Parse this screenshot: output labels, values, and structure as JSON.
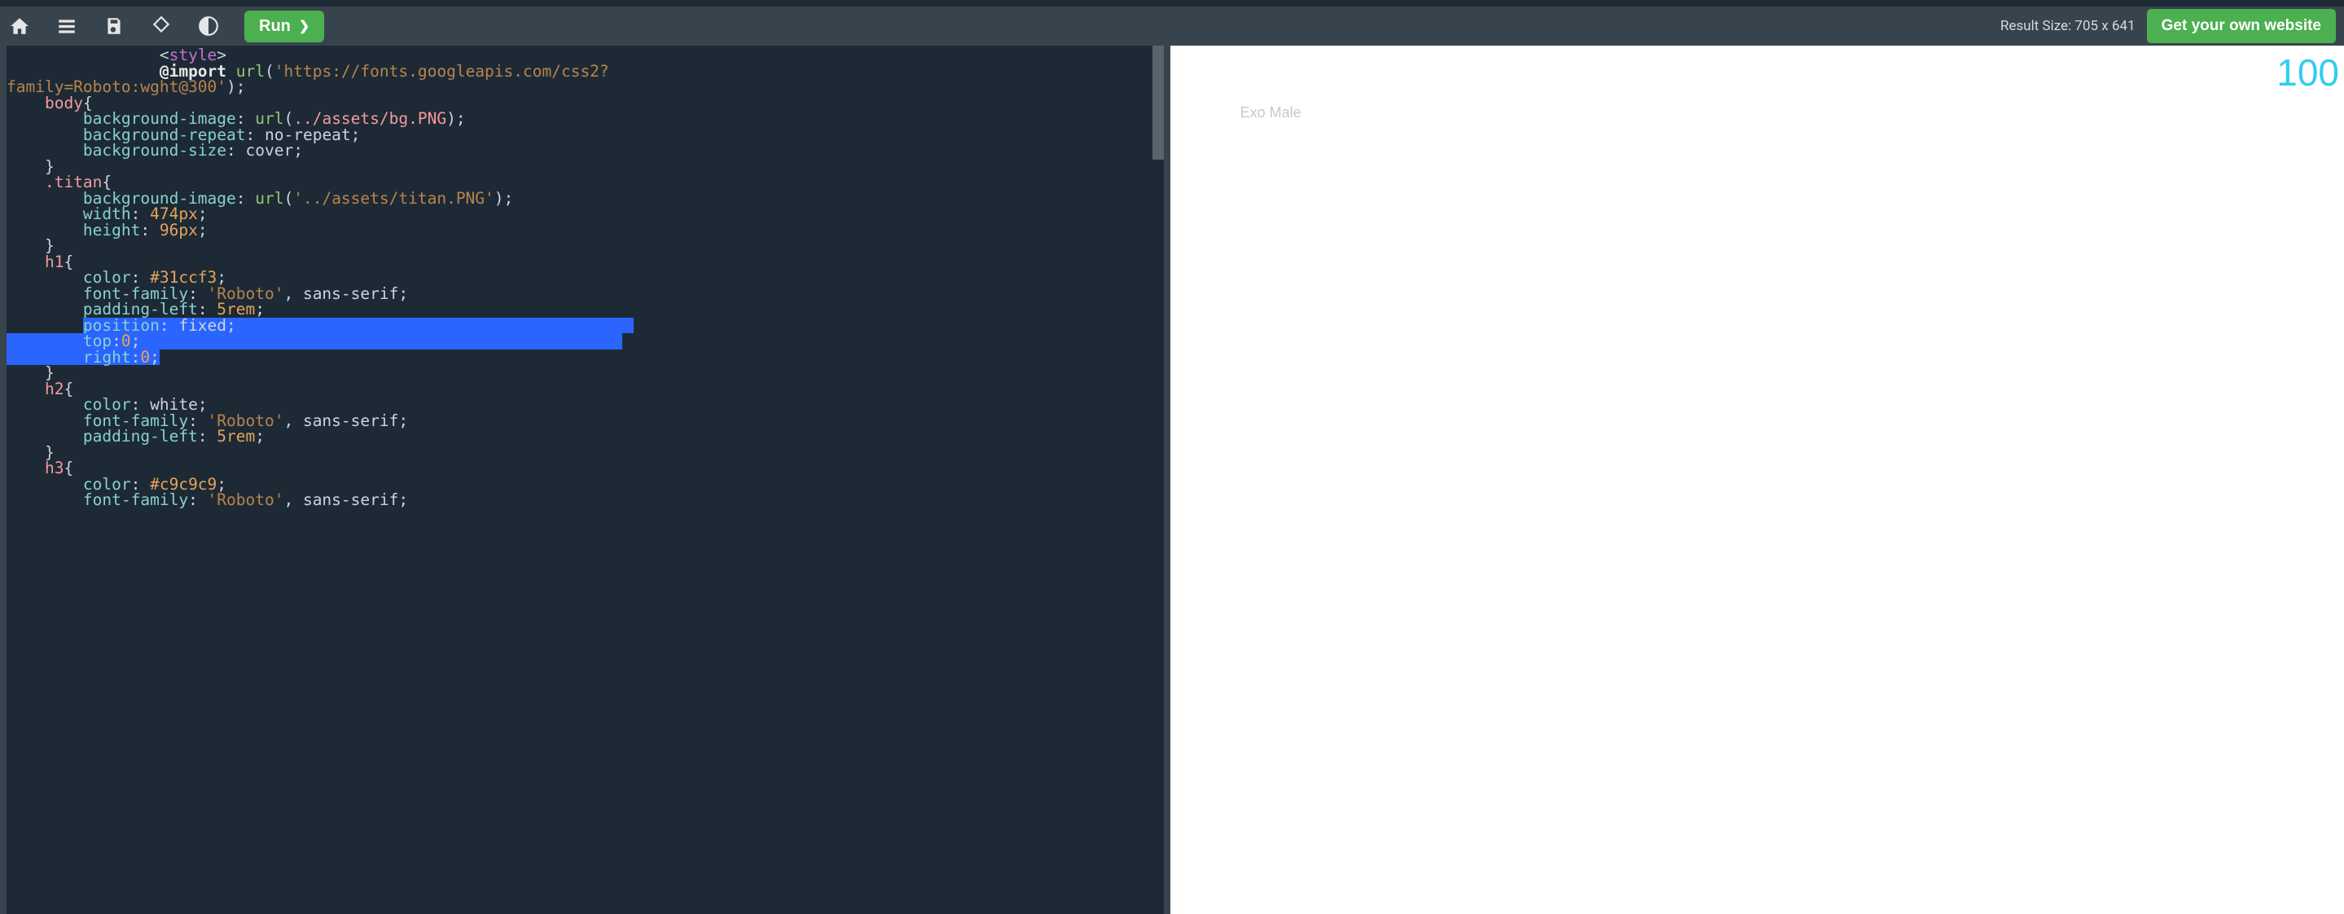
{
  "toolbar": {
    "run_label": "Run",
    "result_size_label": "Result Size: 705 x 641",
    "cta_label": "Get your own website"
  },
  "icons": {
    "home": "home-icon",
    "menu": "menu-icon",
    "save": "save-icon",
    "rotate": "rotate-icon",
    "theme": "theme-icon"
  },
  "preview": {
    "h1_text": "100",
    "h3_text": "Exo Male"
  },
  "editor": {
    "lines": [
      {
        "indent": 16,
        "tokens": [
          [
            "pun",
            "<"
          ],
          [
            "tag",
            "style"
          ],
          [
            "pun",
            ">"
          ]
        ]
      },
      {
        "indent": 16,
        "tokens": [
          [
            "kw",
            "@import"
          ],
          [
            "cm",
            " "
          ],
          [
            "fn",
            "url"
          ],
          [
            "pun",
            "("
          ],
          [
            "str",
            "'https://fonts.googleapis.com/css2?"
          ]
        ]
      },
      {
        "indent": 0,
        "tokens": [
          [
            "str",
            "family=Roboto:wght@300'"
          ],
          [
            "pun",
            ");"
          ]
        ]
      },
      {
        "indent": 4,
        "tokens": [
          [
            "sel",
            "body"
          ],
          [
            "pun",
            "{"
          ]
        ]
      },
      {
        "indent": 8,
        "tokens": [
          [
            "prop",
            "background-image"
          ],
          [
            "pun",
            ": "
          ],
          [
            "fn",
            "url"
          ],
          [
            "pun",
            "("
          ],
          [
            "strpink",
            "../assets/bg.PNG"
          ],
          [
            "pun",
            ");"
          ]
        ]
      },
      {
        "indent": 8,
        "tokens": [
          [
            "prop",
            "background-repeat"
          ],
          [
            "pun",
            ": "
          ],
          [
            "cm",
            "no-repeat"
          ],
          [
            "pun",
            ";"
          ]
        ]
      },
      {
        "indent": 8,
        "tokens": [
          [
            "prop",
            "background-size"
          ],
          [
            "pun",
            ": "
          ],
          [
            "cm",
            "cover"
          ],
          [
            "pun",
            ";"
          ]
        ]
      },
      {
        "indent": 4,
        "tokens": [
          [
            "pun",
            "}"
          ]
        ]
      },
      {
        "indent": 4,
        "tokens": [
          [
            "sel",
            ".titan"
          ],
          [
            "pun",
            "{"
          ]
        ]
      },
      {
        "indent": 8,
        "tokens": [
          [
            "prop",
            "background-image"
          ],
          [
            "pun",
            ": "
          ],
          [
            "fn",
            "url"
          ],
          [
            "pun",
            "("
          ],
          [
            "str",
            "'../assets/titan.PNG'"
          ],
          [
            "pun",
            ");"
          ]
        ]
      },
      {
        "indent": 8,
        "tokens": [
          [
            "prop",
            "width"
          ],
          [
            "pun",
            ": "
          ],
          [
            "num",
            "474px"
          ],
          [
            "pun",
            ";"
          ]
        ]
      },
      {
        "indent": 8,
        "tokens": [
          [
            "prop",
            "height"
          ],
          [
            "pun",
            ": "
          ],
          [
            "num",
            "96px"
          ],
          [
            "pun",
            ";"
          ]
        ]
      },
      {
        "indent": 4,
        "tokens": [
          [
            "pun",
            "}"
          ]
        ]
      },
      {
        "indent": 4,
        "tokens": [
          [
            "sel",
            "h1"
          ],
          [
            "pun",
            "{"
          ]
        ]
      },
      {
        "indent": 8,
        "tokens": [
          [
            "prop",
            "color"
          ],
          [
            "pun",
            ": "
          ],
          [
            "hex",
            "#31ccf3"
          ],
          [
            "pun",
            ";"
          ]
        ]
      },
      {
        "indent": 8,
        "tokens": [
          [
            "prop",
            "font-family"
          ],
          [
            "pun",
            ": "
          ],
          [
            "str",
            "'Roboto'"
          ],
          [
            "pun",
            ", "
          ],
          [
            "cm",
            "sans-serif"
          ],
          [
            "pun",
            ";"
          ]
        ]
      },
      {
        "indent": 8,
        "tokens": [
          [
            "prop",
            "padding-left"
          ],
          [
            "pun",
            ": "
          ],
          [
            "num",
            "5rem"
          ],
          [
            "pun",
            ";"
          ]
        ]
      },
      {
        "indent": 8,
        "sel": "partial",
        "tokens": [
          [
            "prop",
            "position"
          ],
          [
            "pun",
            ": "
          ],
          [
            "cm",
            "fixed"
          ],
          [
            "pun",
            ";"
          ]
        ]
      },
      {
        "indent": 8,
        "sel": "full",
        "tokens": [
          [
            "prop",
            "top"
          ],
          [
            "pun",
            ":"
          ],
          [
            "num",
            "0"
          ],
          [
            "pun",
            ";"
          ]
        ]
      },
      {
        "indent": 8,
        "sel": "end",
        "tokens": [
          [
            "prop",
            "right"
          ],
          [
            "pun",
            ":"
          ],
          [
            "num",
            "0"
          ],
          [
            "pun",
            ";"
          ]
        ]
      },
      {
        "indent": 4,
        "tokens": [
          [
            "pun",
            "}"
          ]
        ]
      },
      {
        "indent": 4,
        "tokens": [
          [
            "sel",
            "h2"
          ],
          [
            "pun",
            "{"
          ]
        ]
      },
      {
        "indent": 8,
        "tokens": [
          [
            "prop",
            "color"
          ],
          [
            "pun",
            ": "
          ],
          [
            "cm",
            "white"
          ],
          [
            "pun",
            ";"
          ]
        ]
      },
      {
        "indent": 8,
        "tokens": [
          [
            "prop",
            "font-family"
          ],
          [
            "pun",
            ": "
          ],
          [
            "str",
            "'Roboto'"
          ],
          [
            "pun",
            ", "
          ],
          [
            "cm",
            "sans-serif"
          ],
          [
            "pun",
            ";"
          ]
        ]
      },
      {
        "indent": 8,
        "tokens": [
          [
            "prop",
            "padding-left"
          ],
          [
            "pun",
            ": "
          ],
          [
            "num",
            "5rem"
          ],
          [
            "pun",
            ";"
          ]
        ]
      },
      {
        "indent": 4,
        "tokens": [
          [
            "pun",
            "}"
          ]
        ]
      },
      {
        "indent": 4,
        "tokens": [
          [
            "sel",
            "h3"
          ],
          [
            "pun",
            "{"
          ]
        ]
      },
      {
        "indent": 8,
        "tokens": [
          [
            "prop",
            "color"
          ],
          [
            "pun",
            ": "
          ],
          [
            "hex",
            "#c9c9c9"
          ],
          [
            "pun",
            ";"
          ]
        ]
      },
      {
        "indent": 8,
        "tokens": [
          [
            "prop",
            "font-family"
          ],
          [
            "pun",
            ": "
          ],
          [
            "str",
            "'Roboto'"
          ],
          [
            "pun",
            ", "
          ],
          [
            "cm",
            "sans-serif"
          ],
          [
            "pun",
            ";"
          ]
        ]
      }
    ]
  }
}
